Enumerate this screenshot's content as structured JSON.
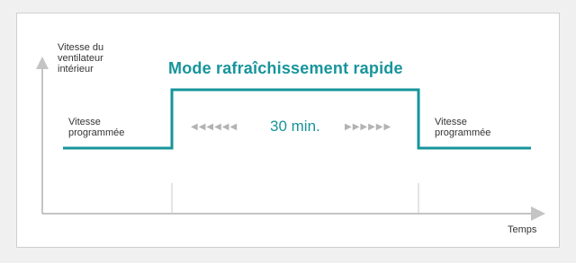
{
  "diagram": {
    "y_axis_label": "Vitesse du\nventilateur\nintérieur",
    "x_axis_label": "Temps",
    "mode_title": "Mode rafraîchissement rapide",
    "duration_label": "30 min.",
    "left_speed_label": "Vitesse\nprogrammée",
    "right_speed_label": "Vitesse\nprogrammée",
    "left_arrows": "◀◀◀◀◀◀",
    "right_arrows": "▶▶▶▶▶▶",
    "colors": {
      "accent": "#17949b",
      "axis": "#b0b0b0",
      "text": "#333333",
      "arrow_glyphs": "#b3b3b3",
      "background": "#f0f0f0",
      "panel": "#ffffff"
    }
  }
}
